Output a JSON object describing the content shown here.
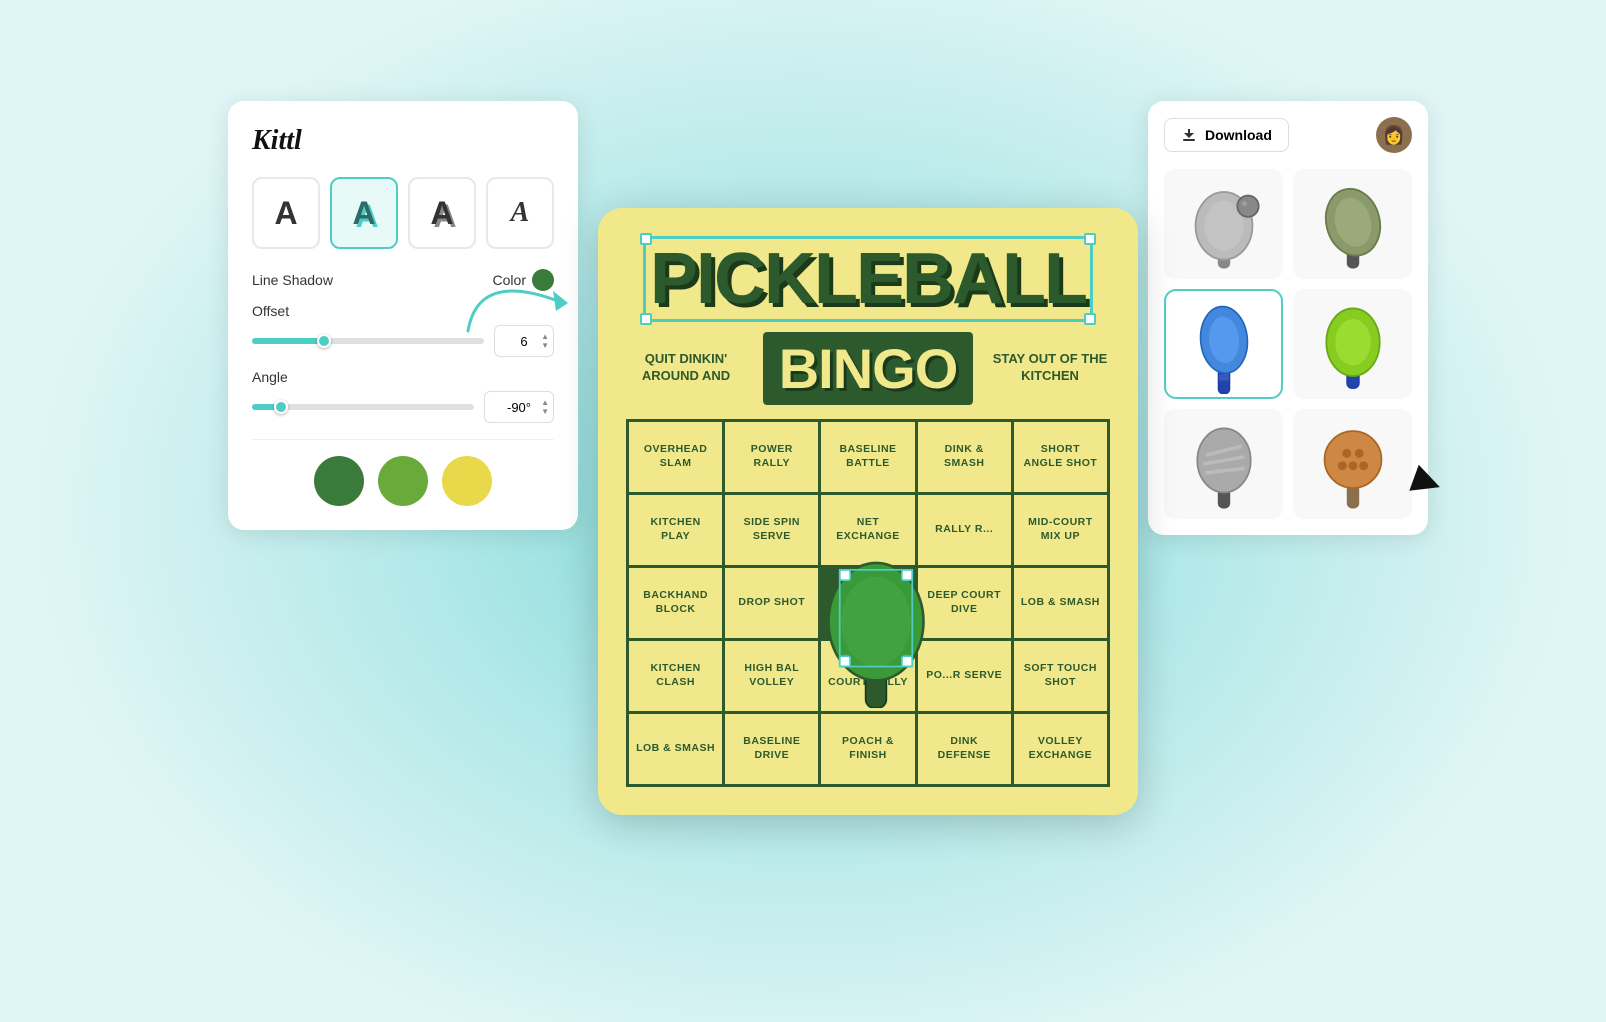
{
  "app": {
    "name": "Kittl"
  },
  "header": {
    "download_label": "Download"
  },
  "left_panel": {
    "text_styles": [
      {
        "id": "plain",
        "label": "A",
        "style": "plain"
      },
      {
        "id": "shadow",
        "label": "A",
        "style": "shadow-active"
      },
      {
        "id": "outline",
        "label": "A",
        "style": "outline"
      },
      {
        "id": "fancy",
        "label": "A",
        "style": "fancy"
      }
    ],
    "line_shadow_label": "Line Shadow",
    "color_label": "Color",
    "offset_label": "Offset",
    "offset_value": "6",
    "angle_label": "Angle",
    "angle_value": "-90°",
    "swatches": [
      "#3a7a3a",
      "#6aaa3a",
      "#e8d84a"
    ]
  },
  "bingo_card": {
    "title": "PICKLEBALL",
    "subtitle": "BINGO",
    "left_text": "QUIT DINKIN' AROUND AND",
    "right_text": "STAY OUT OF THE KITCHEN",
    "cells": [
      "OVERHEAD SLAM",
      "POWER RALLY",
      "BASELINE BATTLE",
      "DINK & SMASH",
      "SHORT ANGLE SHOT",
      "KITCHEN PLAY",
      "SIDE SPIN SERVE",
      "NET EXCHANGE",
      "RALLY R...",
      "MID-COURT MIX UP",
      "BACKHAND BLOCK",
      "DROP SHOT",
      "",
      "DEEP COURT DIVE",
      "LOB & SMASH",
      "KITCHEN CLASH",
      "HIGH BAL VOLLEY",
      "CROSS COURT RALLY",
      "PO...R SERVE",
      "SOFT TOUCH SHOT",
      "LOB & SMASH",
      "BASELINE DRIVE",
      "POACH & FINISH",
      "DINK DEFENSE",
      "VOLLEY EXCHANGE"
    ]
  },
  "right_panel": {
    "paddles": [
      {
        "id": "gray-ball",
        "desc": "gray paddle with ball"
      },
      {
        "id": "purple-paddle",
        "desc": "purple paddle"
      },
      {
        "id": "blue-paddle",
        "desc": "blue paddle - selected"
      },
      {
        "id": "green-paddle",
        "desc": "green paddle"
      },
      {
        "id": "gray-paddle",
        "desc": "gray striped paddle"
      },
      {
        "id": "brown-ball",
        "desc": "brown pickleball"
      }
    ]
  }
}
